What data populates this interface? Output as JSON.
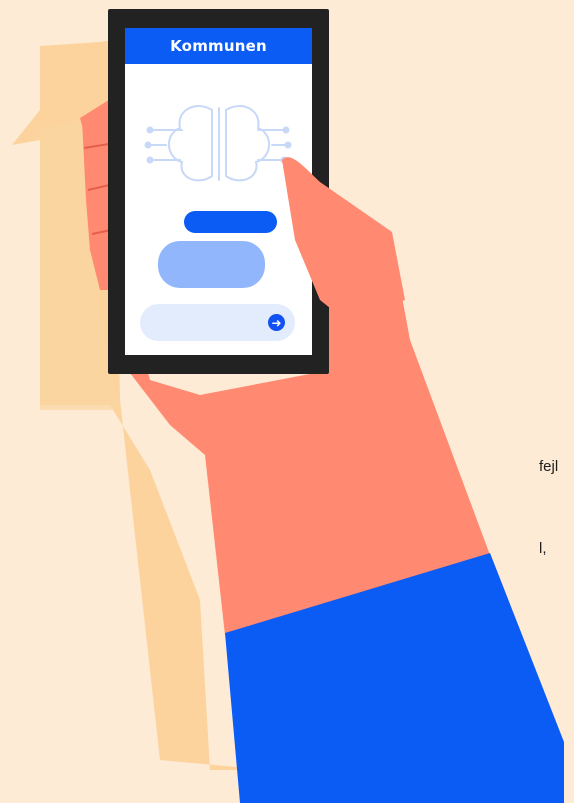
{
  "phone": {
    "header_title": "Kommunen",
    "send_glyph": "➜"
  },
  "background_text": {
    "fragment_1": "fejl",
    "fragment_2": "l,"
  },
  "icons": {
    "brain": "brain-circuit-icon",
    "send": "arrow-right-icon"
  },
  "colors": {
    "background": "#fdebd5",
    "skin": "#ff8a71",
    "sleeve": "#0a5cf5",
    "phone_frame": "#222222",
    "phone_header": "#0a5cf5",
    "bubble_dark": "#0a5cf5",
    "bubble_light": "#91b6fb",
    "input_bg": "#e3ecfd"
  }
}
